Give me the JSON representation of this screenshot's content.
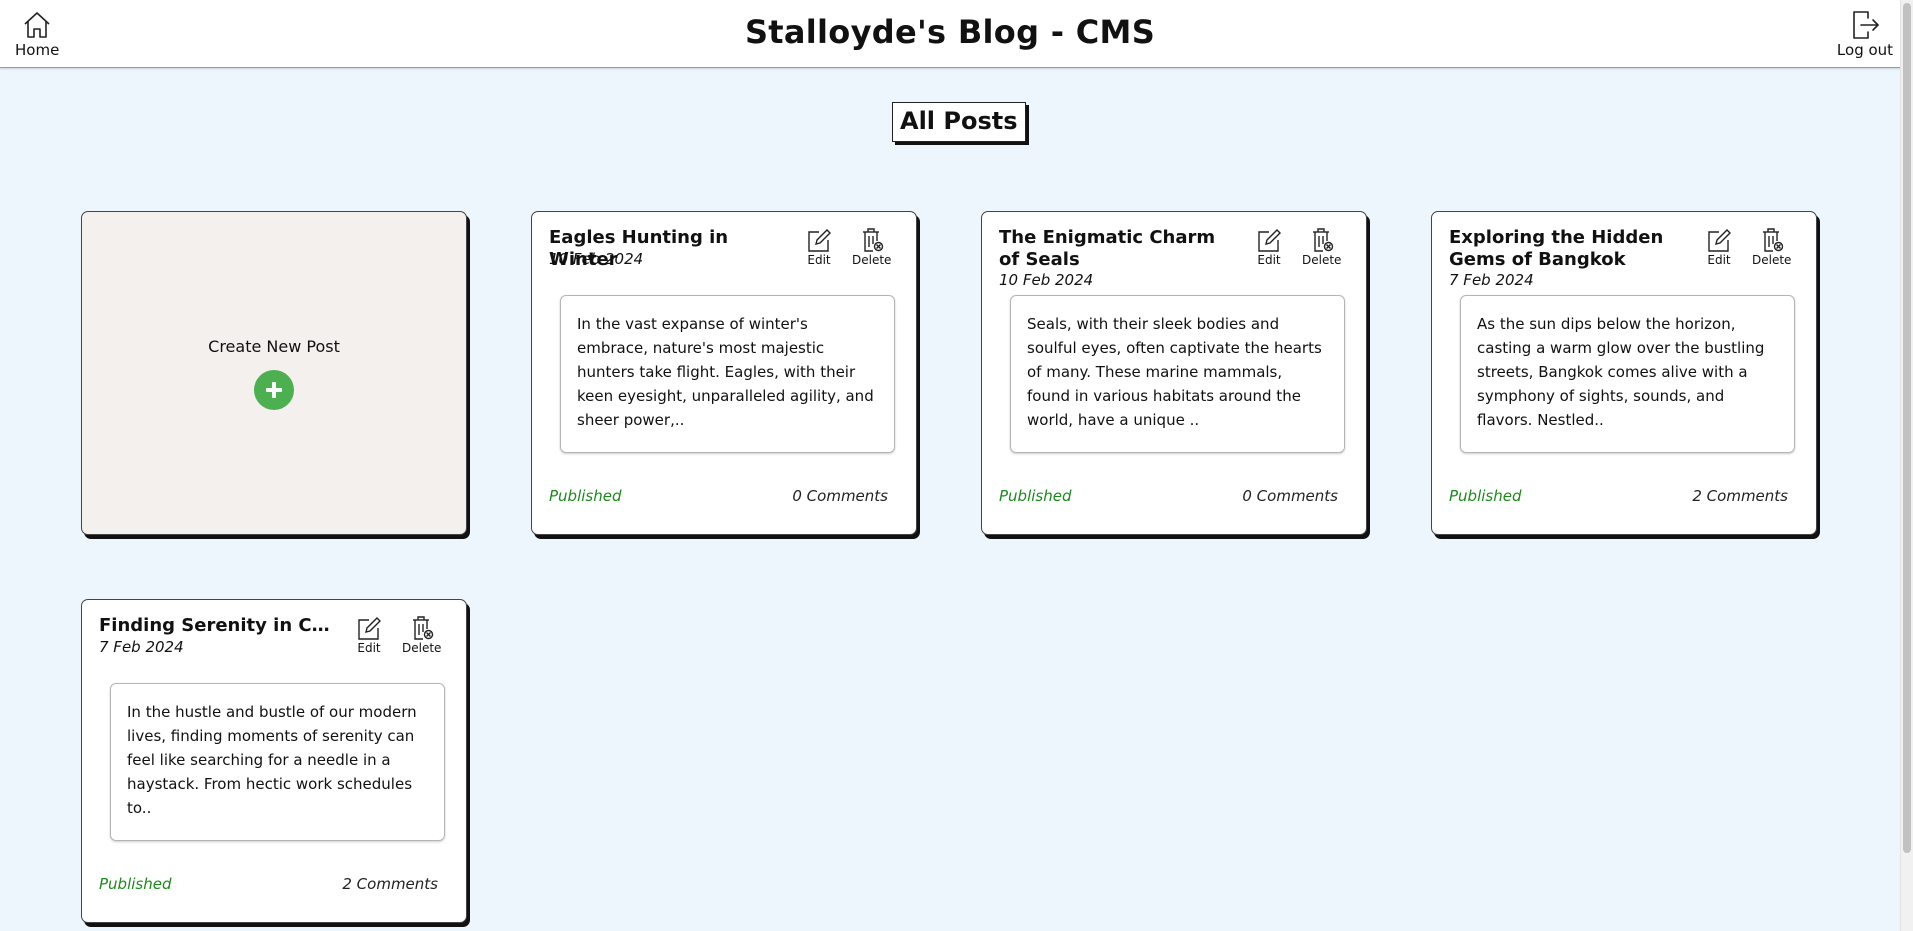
{
  "header": {
    "home_label": "Home",
    "title": "Stalloyde's Blog - CMS",
    "logout_label": "Log out"
  },
  "main": {
    "section_title": "All Posts",
    "create_label": "Create New Post",
    "edit_label": "Edit",
    "delete_label": "Delete",
    "posts": [
      {
        "title": "Eagles Hunting in Winter",
        "date": "10 Feb 2024",
        "excerpt": "In the vast expanse of winter's embrace, nature's most majestic hunters take flight. Eagles, with their keen eyesight, unparalleled agility, and sheer power,..",
        "status": "Published",
        "comments": "0 Comments"
      },
      {
        "title": "The Enigmatic Charm of Seals",
        "date": "10 Feb 2024",
        "excerpt": "Seals, with their sleek bodies and soulful eyes, often captivate the hearts of many. These marine mammals, found in various habitats around the world, have a unique ..",
        "status": "Published",
        "comments": "0 Comments"
      },
      {
        "title": "Exploring the Hidden Gems of Bangkok",
        "date": "7 Feb 2024",
        "excerpt": "As the sun dips below the horizon, casting a warm glow over the bustling streets, Bangkok comes alive with a symphony of sights, sounds, and flavors. Nestled..",
        "status": "Published",
        "comments": "2 Comments"
      },
      {
        "title": "Finding Serenity in Chaos...",
        "date": "7 Feb 2024",
        "excerpt": "In the hustle and bustle of our modern lives, finding moments of serenity can feel like searching for a needle in a haystack. From hectic work schedules to..",
        "status": "Published",
        "comments": "2 Comments"
      }
    ]
  },
  "colors": {
    "page_background": "#edf5fd",
    "create_card_background": "#f4f0ee",
    "create_button": "#4caf50",
    "published_status": "#1a8a1a"
  }
}
